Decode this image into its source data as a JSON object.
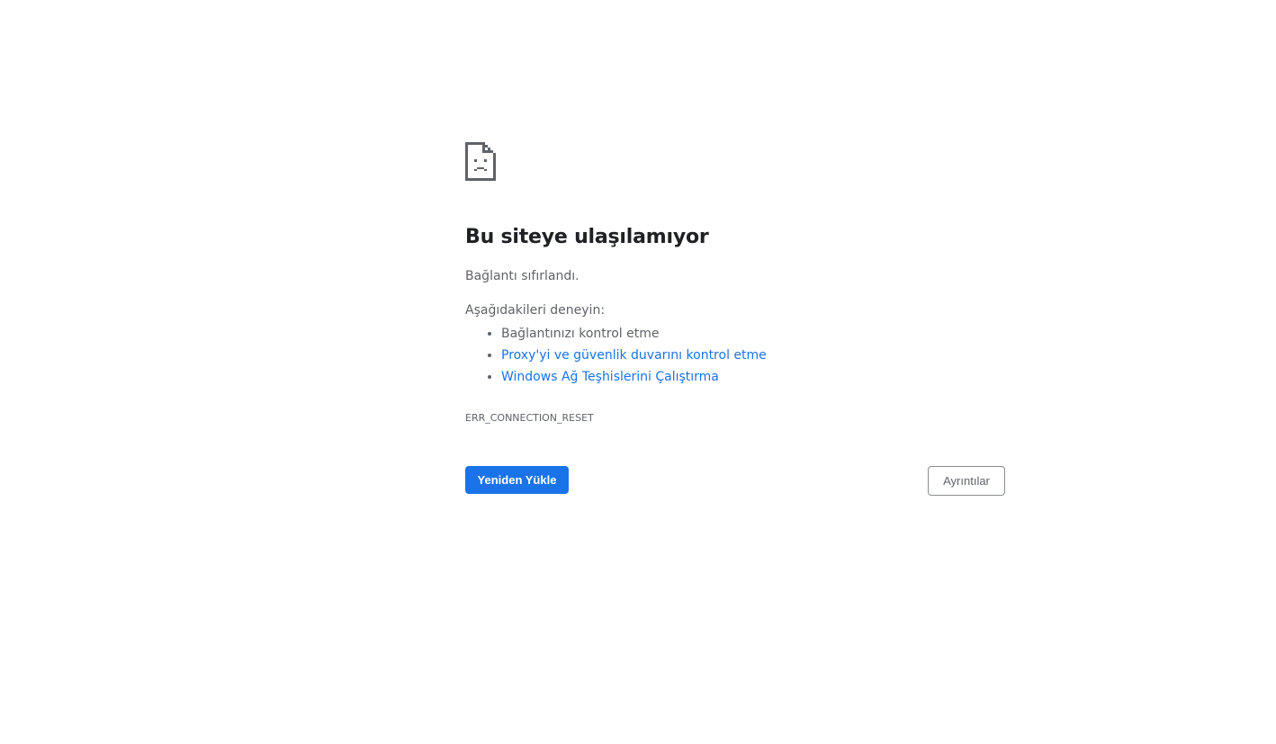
{
  "error_page": {
    "icon": "sad-document-icon",
    "title": "Bu siteye ulaşılamıyor",
    "subtitle": "Bağlantı sıfırlandı.",
    "try_heading": "Aşağıdakileri deneyin:",
    "suggestions": [
      {
        "label": "Bağlantınızı kontrol etme",
        "is_link": false
      },
      {
        "label": "Proxy'yi ve güvenlik duvarını kontrol etme",
        "is_link": true
      },
      {
        "label": "Windows Ağ Teşhislerini Çalıştırma",
        "is_link": true
      }
    ],
    "error_code": "ERR_CONNECTION_RESET"
  },
  "buttons": {
    "reload_label": "Yeniden Yükle",
    "details_label": "Ayrıntılar"
  },
  "colors": {
    "accent": "#1a73e8",
    "title_text": "#202124",
    "secondary_text": "#5f6368",
    "icon": "#5f6368"
  }
}
